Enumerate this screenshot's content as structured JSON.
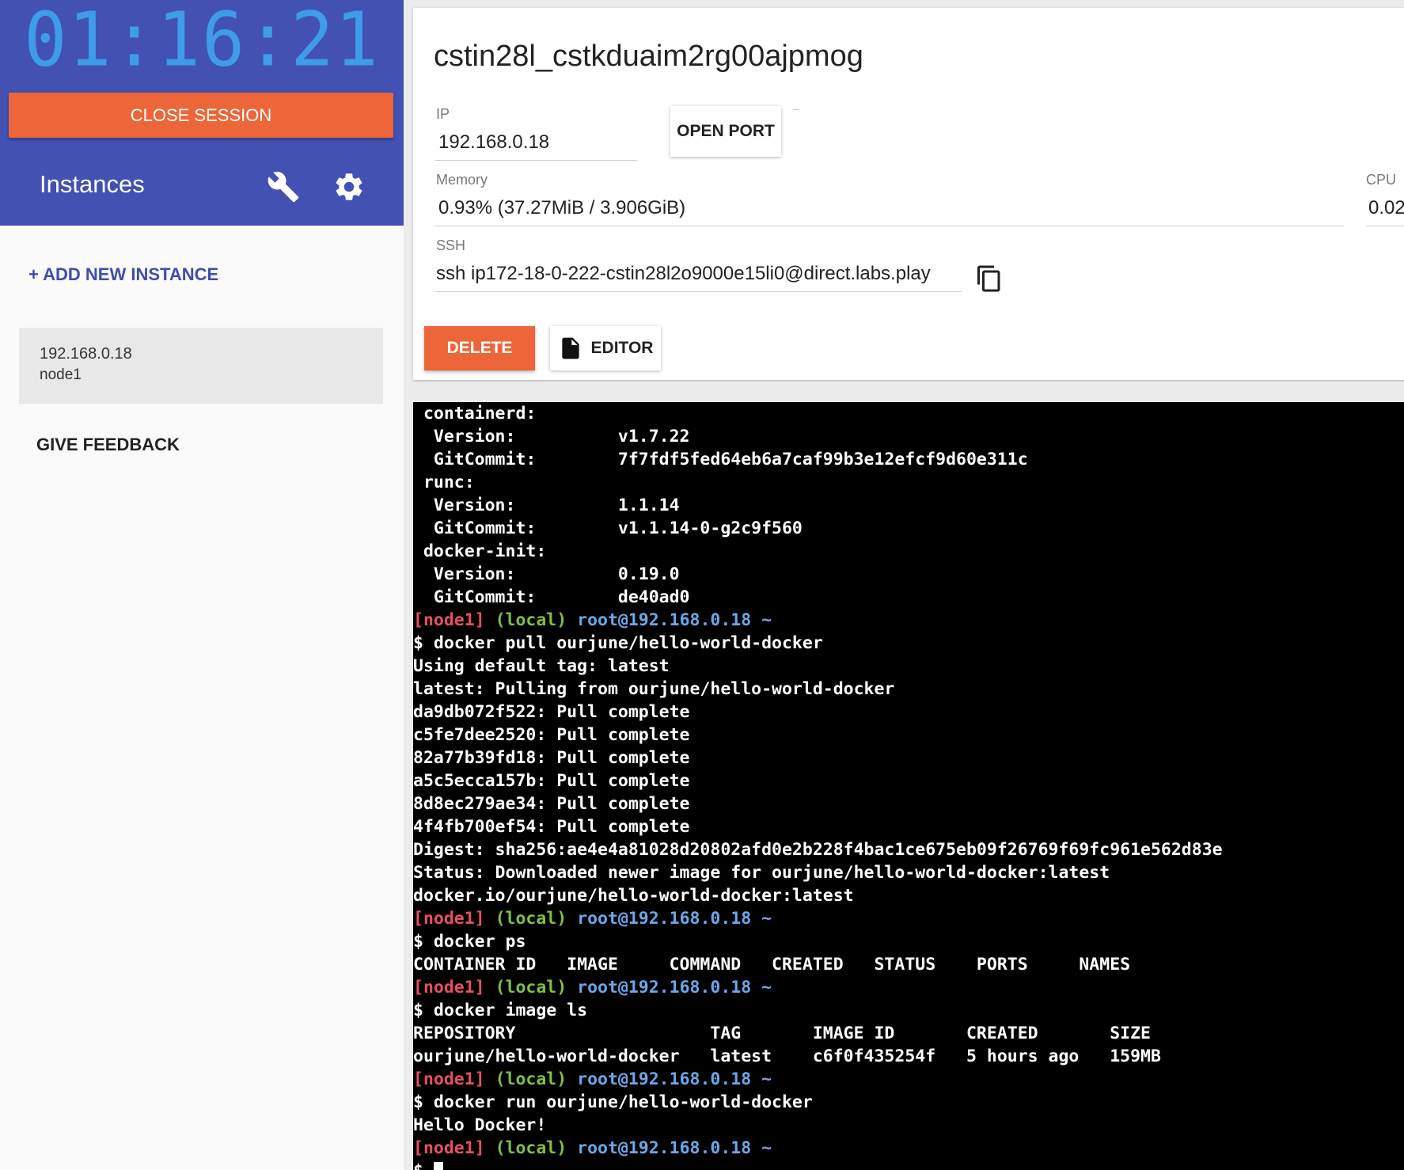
{
  "session": {
    "timer": "01:16:21",
    "close_label": "CLOSE SESSION"
  },
  "sidebar": {
    "title": "Instances",
    "add_instance": "+ ADD NEW INSTANCE",
    "instances": [
      {
        "ip": "192.168.0.18",
        "name": "node1"
      }
    ],
    "feedback": "GIVE FEEDBACK"
  },
  "instance": {
    "title": "cstin28l_cstkduaim2rg00ajpmog",
    "ip_label": "IP",
    "ip_value": "192.168.0.18",
    "open_port": "OPEN PORT",
    "memory_label": "Memory",
    "memory_value": "0.93% (37.27MiB / 3.906GiB)",
    "cpu_label": "CPU",
    "cpu_value": "0.02",
    "ssh_label": "SSH",
    "ssh_value": "ssh ip172-18-0-222-cstin28l2o9000e15li0@direct.labs.play",
    "delete_label": "DELETE",
    "editor_label": "EDITOR"
  },
  "colors": {
    "sidebar_header": "#4351b2",
    "accent_orange": "#ec663a",
    "timer": "#3d9de9",
    "prompt_node": "#e85060",
    "prompt_local": "#7cc242",
    "prompt_user": "#6ba7e9"
  },
  "terminal": {
    "lines": [
      {
        "text": " containerd:"
      },
      {
        "text": "  Version:          v1.7.22"
      },
      {
        "text": "  GitCommit:        7f7fdf5fed64eb6a7caf99b3e12efcf9d60e311c"
      },
      {
        "text": " runc:"
      },
      {
        "text": "  Version:          1.1.14"
      },
      {
        "text": "  GitCommit:        v1.1.14-0-g2c9f560"
      },
      {
        "text": " docker-init:"
      },
      {
        "text": "  Version:          0.19.0"
      },
      {
        "text": "  GitCommit:        de40ad0"
      },
      {
        "prompt": true,
        "node": "[node1]",
        "local": "(local)",
        "user": "root@192.168.0.18",
        "tilde": "~"
      },
      {
        "text": "$ docker pull ourjune/hello-world-docker"
      },
      {
        "text": "Using default tag: latest"
      },
      {
        "text": "latest: Pulling from ourjune/hello-world-docker"
      },
      {
        "text": "da9db072f522: Pull complete"
      },
      {
        "text": "c5fe7dee2520: Pull complete"
      },
      {
        "text": "82a77b39fd18: Pull complete"
      },
      {
        "text": "a5c5ecca157b: Pull complete"
      },
      {
        "text": "8d8ec279ae34: Pull complete"
      },
      {
        "text": "4f4fb700ef54: Pull complete"
      },
      {
        "text": "Digest: sha256:ae4e4a81028d20802afd0e2b228f4bac1ce675eb09f26769f69fc961e562d83e"
      },
      {
        "text": "Status: Downloaded newer image for ourjune/hello-world-docker:latest"
      },
      {
        "text": "docker.io/ourjune/hello-world-docker:latest"
      },
      {
        "prompt": true,
        "node": "[node1]",
        "local": "(local)",
        "user": "root@192.168.0.18",
        "tilde": "~"
      },
      {
        "text": "$ docker ps"
      },
      {
        "text": "CONTAINER ID   IMAGE     COMMAND   CREATED   STATUS    PORTS     NAMES"
      },
      {
        "prompt": true,
        "node": "[node1]",
        "local": "(local)",
        "user": "root@192.168.0.18",
        "tilde": "~"
      },
      {
        "text": "$ docker image ls"
      },
      {
        "text": "REPOSITORY                   TAG       IMAGE ID       CREATED       SIZE"
      },
      {
        "text": "ourjune/hello-world-docker   latest    c6f0f435254f   5 hours ago   159MB"
      },
      {
        "prompt": true,
        "node": "[node1]",
        "local": "(local)",
        "user": "root@192.168.0.18",
        "tilde": "~"
      },
      {
        "text": "$ docker run ourjune/hello-world-docker"
      },
      {
        "text": "Hello Docker!"
      },
      {
        "prompt": true,
        "node": "[node1]",
        "local": "(local)",
        "user": "root@192.168.0.18",
        "tilde": "~"
      },
      {
        "text": "$ ",
        "cursor": true
      }
    ]
  }
}
